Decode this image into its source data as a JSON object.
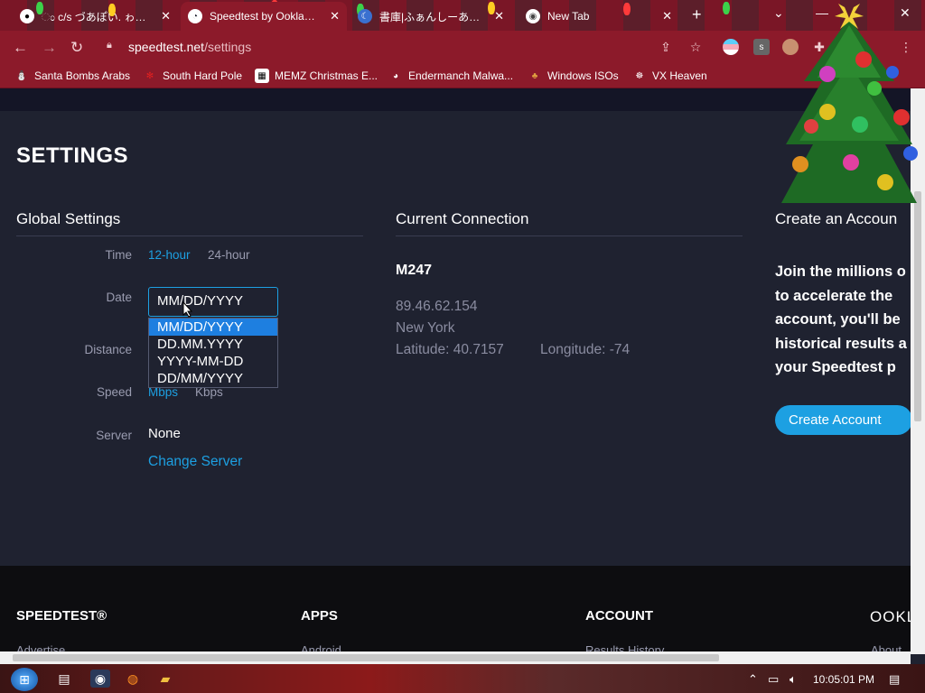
{
  "tabs": [
    {
      "title": "ಂ c/s づあぽい. ゎおいぐｖ",
      "icon": "panda-icon"
    },
    {
      "title": "Speedtest by Ookla - T",
      "icon": "speedtest-icon",
      "active": true
    },
    {
      "title": "書庫|ふぁんしーあいらんど",
      "icon": "moon-icon"
    },
    {
      "title": "New Tab",
      "icon": "chrome-icon"
    }
  ],
  "address_bar": {
    "domain": "speedtest.net",
    "path": "/settings"
  },
  "bookmarks": [
    {
      "label": "Santa Bombs Arabs",
      "icon": "santa-icon"
    },
    {
      "label": "South Hard Pole",
      "icon": "snowflake-icon"
    },
    {
      "label": "MEMZ Christmas E...",
      "icon": "memz-icon"
    },
    {
      "label": "Endermanch Malwa...",
      "icon": "panda-icon"
    },
    {
      "label": "Windows ISOs",
      "icon": "tree-icon"
    },
    {
      "label": "VX Heaven",
      "icon": "vx-icon"
    }
  ],
  "page": {
    "title": "SETTINGS",
    "global_settings": {
      "heading": "Global Settings",
      "time_label": "Time",
      "time_options": [
        "12-hour",
        "24-hour"
      ],
      "date_label": "Date",
      "date_value": "MM/DD/YYYY",
      "date_options": [
        "MM/DD/YYYY",
        "DD.MM.YYYY",
        "YYYY-MM-DD",
        "DD/MM/YYYY"
      ],
      "distance_label": "Distance",
      "speed_label": "Speed",
      "speed_options": [
        "Mbps",
        "Kbps"
      ],
      "server_label": "Server",
      "server_value": "None",
      "change_server": "Change Server"
    },
    "current_connection": {
      "heading": "Current Connection",
      "isp": "M247",
      "ip": "89.46.62.154",
      "city": "New York",
      "latitude": "Latitude: 40.7157",
      "longitude": "Longitude: -74"
    },
    "create_account": {
      "heading": "Create an Accoun",
      "lines": [
        "Join the millions o",
        "to accelerate the",
        "account, you'll be",
        "historical results a",
        "your Speedtest p"
      ],
      "button": "Create Account"
    }
  },
  "footer": {
    "columns": [
      {
        "heading": "SPEEDTEST®",
        "link": "Advertise"
      },
      {
        "heading": "APPS",
        "link": "Android"
      },
      {
        "heading": "ACCOUNT",
        "link": "Results History"
      }
    ],
    "logo": "OOKL",
    "extra_link": "About"
  },
  "taskbar": {
    "time": "10:05:01 PM"
  },
  "colors": {
    "accent": "#1da0e2",
    "chrome_bar": "#8c1a2a",
    "page_bg": "#1f2230"
  }
}
